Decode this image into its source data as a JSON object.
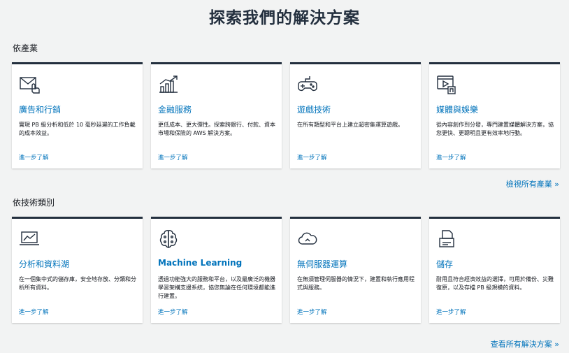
{
  "page_title": "探索我們的解決方案",
  "industry": {
    "label": "依產業",
    "see_all": "檢視所有產業 »",
    "cards": [
      {
        "icon": "ad-mail-icon",
        "title": "廣告和行銷",
        "desc": "實現 PB 級分析和低於 10 毫秒延遲的工作負載的成本效益。",
        "more": "進一步了解"
      },
      {
        "icon": "growth-chart-icon",
        "title": "金融服務",
        "desc": "更低成本、更大彈性。探索跨銀行、付款、資本市場和保險的 AWS 解決方案。",
        "more": "進一步了解"
      },
      {
        "icon": "game-controller-icon",
        "title": "遊戲技術",
        "desc": "在所有類型和平台上建立超密集運算遊戲。",
        "more": "進一步了解"
      },
      {
        "icon": "media-player-icon",
        "title": "媒體與娛樂",
        "desc": "從內容創作到分發，專門建置媒體解決方案，協您更快、更聰明且更有效率地行動。",
        "more": "進一步了解"
      }
    ]
  },
  "technology": {
    "label": "依技術類別",
    "see_all": "查看所有解決方案 »",
    "cards": [
      {
        "icon": "analytics-monitor-icon",
        "title": "分析和資料湖",
        "desc": "在一個集中式的儲存庫，安全地存放、分類和分析所有資料。",
        "more": "進一步了解",
        "bold": false
      },
      {
        "icon": "brain-chip-icon",
        "title": "Machine Learning",
        "desc": "透過功能強大的服務和平台，以及最廣泛的機器學習架構支援系統，協您無論在任何環境都能進行建置。",
        "more": "進一步了解",
        "bold": true
      },
      {
        "icon": "cloud-icon",
        "title": "無伺服器運算",
        "desc": "在無須管理伺服器的情況下，建置和執行應用程式與服務。",
        "more": "進一步了解",
        "bold": false
      },
      {
        "icon": "storage-printer-icon",
        "title": "儲存",
        "desc": "耐用且符合經濟效益的選擇，可用於備份、災難復原，以及存檔 PB 級規模的資料。",
        "more": "進一步了解",
        "bold": false
      }
    ]
  }
}
